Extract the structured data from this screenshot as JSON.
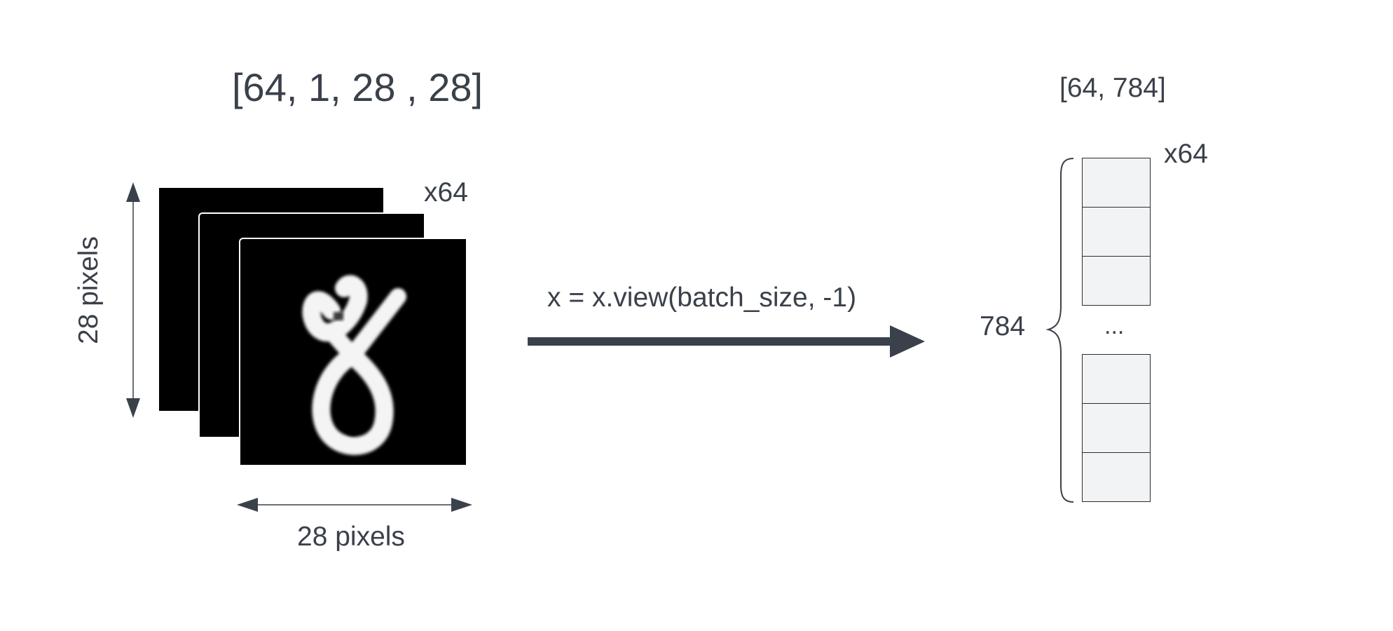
{
  "input": {
    "shape_label": "[64, 1, 28 , 28]",
    "count_label": "x64",
    "height_label": "28 pixels",
    "width_label": "28 pixels"
  },
  "transform": {
    "code_label": "x = x.view(batch_size, -1)"
  },
  "output": {
    "shape_label": "[64, 784]",
    "count_label": "x64",
    "length_label": "784",
    "ellipsis": "..."
  },
  "colors": {
    "ink": "#3a414a",
    "arrow": "#3a414a",
    "cell_fill": "#f2f3f4",
    "image_bg": "#000000"
  }
}
